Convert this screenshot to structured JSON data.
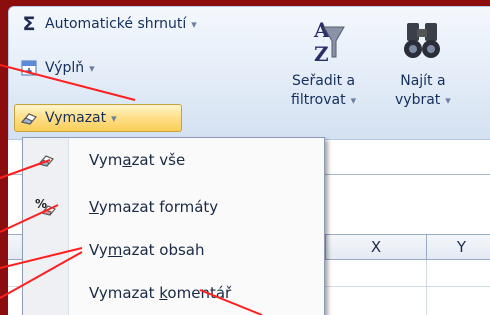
{
  "ribbon": {
    "autosum": {
      "label": "Automatické shrnutí",
      "caret": "▾",
      "icon": "sigma-icon"
    },
    "fill": {
      "label": "Výplň",
      "caret": "▾",
      "icon": "fill-down-icon"
    },
    "clear": {
      "label": "Vymazat",
      "caret": "▾",
      "icon": "eraser-icon"
    },
    "sort_filter": {
      "line1": "Seřadit a",
      "line2": "filtrovat",
      "caret": "▾",
      "icon": "sort-filter-icon"
    },
    "find_select": {
      "line1": "Najít a",
      "line2": "vybrat",
      "caret": "▾",
      "icon": "binoculars-icon"
    }
  },
  "sheet": {
    "columns": [
      "X",
      "Y"
    ]
  },
  "clear_menu": {
    "items": [
      {
        "pre": "Vym",
        "key": "a",
        "post": "zat vše",
        "icon": "eraser-icon"
      },
      {
        "pre": "",
        "key": "V",
        "post": "ymazat formáty",
        "icon": "clear-formats-icon"
      },
      {
        "pre": "Vy",
        "key": "m",
        "post": "azat obsah",
        "icon": ""
      },
      {
        "pre": "Vymazat ",
        "key": "k",
        "post": "omentář",
        "icon": ""
      }
    ]
  },
  "colors": {
    "background": "#8b0d0d",
    "ribbon": "#e3ecf7",
    "active_button": "#fbcd58",
    "arrow": "#ff2020",
    "text": "#15305c"
  }
}
